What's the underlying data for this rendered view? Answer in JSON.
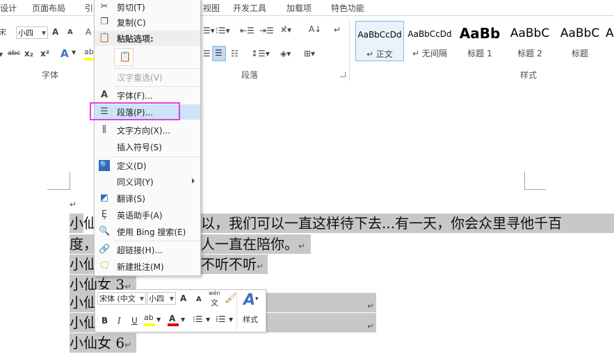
{
  "ribbon_tabs": [
    "设计",
    "页面布局",
    "引",
    "视图",
    "开发工具",
    "加载项",
    "特色功能"
  ],
  "font_group": {
    "label": "字体",
    "font_name_partial": "宋",
    "font_size": "小四",
    "grow_font": "A",
    "shrink_font": "A",
    "strikethrough": "abc",
    "subscript": "x₂",
    "superscript": "x²",
    "text_effect": "A"
  },
  "paragraph_group": {
    "label": "段落"
  },
  "styles_group": {
    "label": "样式",
    "items": [
      {
        "sample": "AaBbCcDd",
        "name": "↵ 正文"
      },
      {
        "sample": "AaBbCcDd",
        "name": "↵ 无间隔"
      },
      {
        "sample": "AaBb",
        "name": "标题 1"
      },
      {
        "sample": "AaBbC",
        "name": "标题 2"
      },
      {
        "sample": "AaBbC",
        "name": "标题"
      },
      {
        "sample": "A",
        "name": ""
      }
    ]
  },
  "context_menu": {
    "cut": "剪切(T)",
    "copy": "复制(C)",
    "paste_options": "粘贴选项:",
    "reconvert": "汉字重选(V)",
    "font": "字体(F)...",
    "paragraph": "段落(P)...",
    "text_direction": "文字方向(X)...",
    "insert_symbol": "插入符号(S)",
    "define": "定义(D)",
    "synonyms": "同义词(Y)",
    "translate": "翻译(S)",
    "english_assistant": "英语助手(A)",
    "bing_search": "使用 Bing 搜索(E)",
    "hyperlink": "超链接(H)...",
    "new_comment": "新建批注(M)"
  },
  "document": {
    "line1_a": "小仙",
    "line1_b": "以，我们可以一直这样待下去...有一天，你会众里寻他千百",
    "line2_a": "度，",
    "line2_b": "人一直在陪你。",
    "line3_a": "小仙",
    "line3_b": "不听不听",
    "line4": "小仙女 3",
    "line5_a": "小仙",
    "line6_a": "小仙",
    "line7": "小仙女 6",
    "para_mark": "↵"
  },
  "mini_toolbar": {
    "font_name": "宋体 (中文",
    "font_size": "小四",
    "grow": "A",
    "shrink": "A",
    "phonetic": "wén",
    "phonetic_char": "文",
    "bold": "B",
    "italic": "I",
    "underline": "U",
    "highlight": "ab",
    "font_color": "A",
    "styles_label": "样式"
  },
  "colors": {
    "highlight_yellow": "#ffff00",
    "font_red": "#e00000",
    "selection_gray": "#c8c8c8",
    "annotation_magenta": "#e040e0",
    "menu_highlight": "#cde3f7"
  }
}
